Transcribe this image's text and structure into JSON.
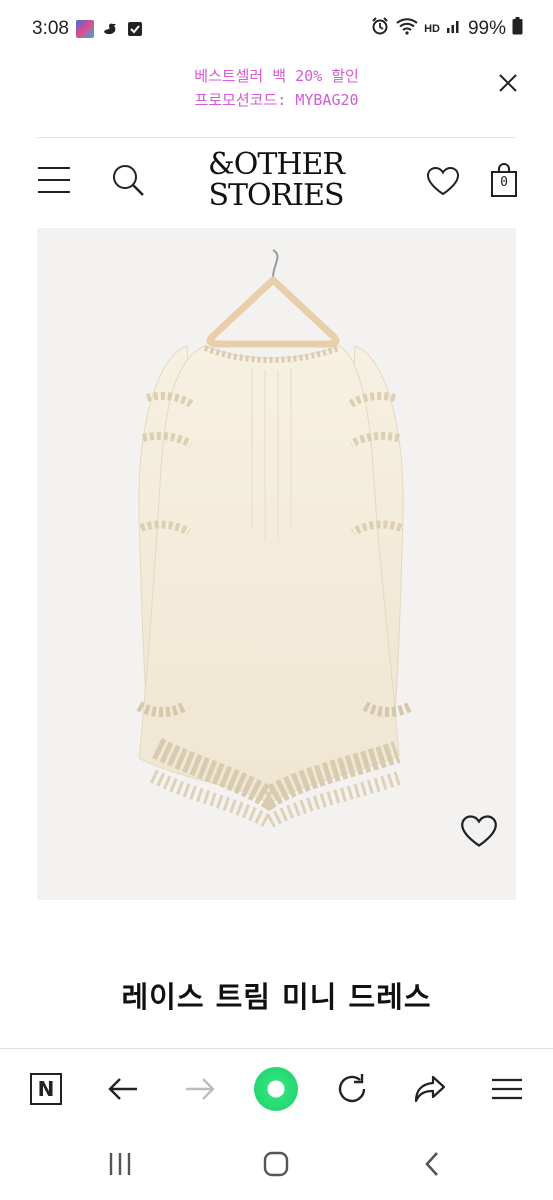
{
  "status_bar": {
    "time": "3:08",
    "battery": "99%",
    "hd_label": "HD"
  },
  "promo": {
    "line1": "베스트셀러 백 20% 할인",
    "line2": "프로모션코드: MYBAG20"
  },
  "header": {
    "logo_line1": "&OTHER",
    "logo_line2": "STORIES",
    "cart_count": "0"
  },
  "product": {
    "title": "레이스 트림 미니 드레스"
  },
  "browser_bar": {
    "home_letter": "N"
  },
  "colors": {
    "promo_text": "#d35bd3",
    "brand_green": "#22d36b",
    "image_bg": "#f3f2f1",
    "dress": "#f6efdf"
  }
}
